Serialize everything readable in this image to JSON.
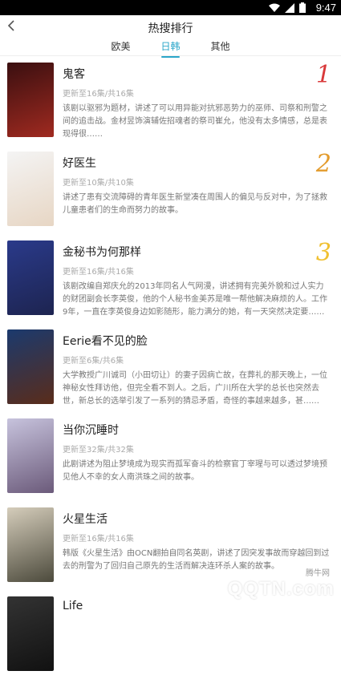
{
  "status_bar": {
    "time": "9:47"
  },
  "header": {
    "title": "热搜排行",
    "tabs": [
      {
        "label": "欧美",
        "active": false
      },
      {
        "label": "日韩",
        "active": true
      },
      {
        "label": "其他",
        "active": false
      }
    ]
  },
  "list": [
    {
      "title": "鬼客",
      "meta": "更新至16集/共16集",
      "desc": "该剧以驱邪为题材，讲述了可以用异能对抗邪恶势力的巫师、司祭和刑警之间的追击战。金材昱饰演辅佐招魂者的祭司崔允，他没有太多情感，总是表现得很……",
      "rank": "1",
      "rank_color": "#d9393a",
      "poster_colors": [
        "#3a0f10",
        "#a02a20"
      ]
    },
    {
      "title": "好医生",
      "meta": "更新至10集/共10集",
      "desc": "讲述了患有交流障碍的青年医生新堂凑在周围人的偏见与反对中，为了拯救儿童患者们的生命而努力的故事。",
      "rank": "2",
      "rank_color": "#e39b2c",
      "poster_colors": [
        "#f4f4f4",
        "#e7d6c4"
      ]
    },
    {
      "title": "金秘书为何那样",
      "meta": "更新至16集/共16集",
      "desc": "该剧改编自郑庆允的2013年同名人气网漫，讲述拥有完美外貌和过人实力的财团副会长李英俊，他的个人秘书金美苏是唯一帮他解决麻烦的人。工作9年，一直在李英俊身边如影随形，能力满分的她，有一天突然决定要……",
      "rank": "3",
      "rank_color": "#f0c030",
      "poster_colors": [
        "#2a3a8a",
        "#1d2450"
      ]
    },
    {
      "title": "Eerie看不见的脸",
      "meta": "更新至6集/共6集",
      "desc": "大学教授广川诚司（小田切让）的妻子因病亡故，在葬礼的那天晚上，一位神秘女性拜访他，但完全看不到人。之后，广川所在大学的总长也突然去世，新总长的选举引发了一系列的猜忌矛盾，奇怪的事越来越多，甚……",
      "rank": "",
      "rank_color": "#999999",
      "poster_colors": [
        "#1b3a6e",
        "#5a2c1a"
      ]
    },
    {
      "title": "当你沉睡时",
      "meta": "更新至32集/共32集",
      "desc": "此剧讲述为阻止梦境成为现实而孤军奋斗的检察官丁宰瑆与可以透过梦境预见他人不幸的女人南洪珠之间的故事。",
      "rank": "",
      "rank_color": "#999999",
      "poster_colors": [
        "#c7c3dd",
        "#6b5a7a"
      ]
    },
    {
      "title": "火星生活",
      "meta": "更新至16集/共16集",
      "desc": "韩版《火星生活》由OCN翻拍自同名英剧，讲述了因突发事故而穿越回到过去的刑警为了回归自己原先的生活而解决连环杀人案的故事。",
      "rank": "",
      "rank_color": "#999999",
      "poster_colors": [
        "#d5cdbb",
        "#4c4a3c"
      ]
    },
    {
      "title": "Life",
      "meta": "",
      "desc": "",
      "rank": "",
      "rank_color": "#999999",
      "poster_colors": [
        "#333333",
        "#111111"
      ]
    }
  ],
  "watermark": {
    "small": "腾牛网",
    "big": "QQTN.com"
  }
}
